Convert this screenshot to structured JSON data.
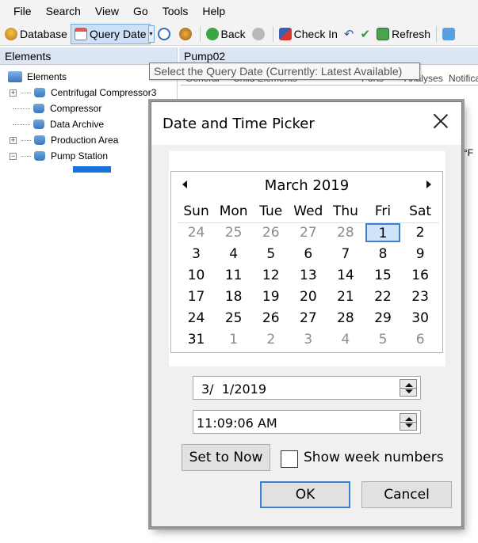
{
  "menu": [
    "File",
    "Search",
    "View",
    "Go",
    "Tools",
    "Help"
  ],
  "toolbar": {
    "database": "Database",
    "query_date": "Query Date",
    "back": "Back",
    "check_in": "Check In",
    "refresh": "Refresh"
  },
  "left_panel": {
    "header": "Elements",
    "tree": [
      "Elements",
      "Centrifugal Compressor3",
      "Compressor",
      "Data Archive",
      "Production Area",
      "Pump Station"
    ]
  },
  "right_panel": {
    "header": "Pump02",
    "tabs": [
      "General",
      "Child Elements",
      "Ports",
      "Analyses",
      "Notifica"
    ],
    "partial_cell": "°F"
  },
  "tooltip": "Select the Query Date (Currently: Latest Available)",
  "dialog": {
    "title": "Date and Time Picker",
    "month_label": "March 2019",
    "weekdays": [
      "Sun",
      "Mon",
      "Tue",
      "Wed",
      "Thu",
      "Fri",
      "Sat"
    ],
    "weeks": [
      [
        "24",
        "25",
        "26",
        "27",
        "28",
        "1",
        "2"
      ],
      [
        "3",
        "4",
        "5",
        "6",
        "7",
        "8",
        "9"
      ],
      [
        "10",
        "11",
        "12",
        "13",
        "14",
        "15",
        "16"
      ],
      [
        "17",
        "18",
        "19",
        "20",
        "21",
        "22",
        "23"
      ],
      [
        "24",
        "25",
        "26",
        "27",
        "28",
        "29",
        "30"
      ],
      [
        "31",
        "1",
        "2",
        "3",
        "4",
        "5",
        "6"
      ]
    ],
    "selected_day": "1",
    "date_value": "3/  1/2019",
    "time_value": "11:09:06 AM",
    "set_now_label": "Set to Now",
    "week_numbers_label": "Show week numbers",
    "week_numbers_checked": false,
    "ok_label": "OK",
    "cancel_label": "Cancel"
  },
  "colors": {
    "selection": "#3a80d2",
    "panel_header": "#dce6f2"
  }
}
